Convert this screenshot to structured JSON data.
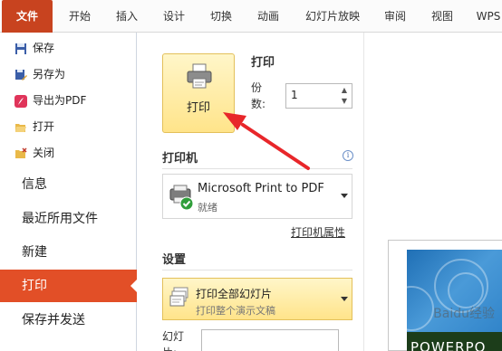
{
  "tabs": [
    "文件",
    "开始",
    "插入",
    "设计",
    "切换",
    "动画",
    "幻灯片放映",
    "审阅",
    "视图",
    "WPS"
  ],
  "nav": {
    "small_items": [
      {
        "label": "保存",
        "icon": "save-icon"
      },
      {
        "label": "另存为",
        "icon": "save-as-icon"
      },
      {
        "label": "导出为PDF",
        "icon": "pdf-icon"
      },
      {
        "label": "打开",
        "icon": "open-folder-icon"
      },
      {
        "label": "关闭",
        "icon": "close-folder-icon"
      }
    ],
    "big_items": [
      "信息",
      "最近所用文件",
      "新建",
      "打印",
      "保存并发送"
    ]
  },
  "print": {
    "section_title": "打印",
    "button_label": "打印",
    "copies_label": "份数:",
    "copies_value": "1",
    "printer_title": "打印机",
    "printer_name": "Microsoft Print to PDF",
    "printer_status": "就绪",
    "printer_props": "打印机属性",
    "settings_title": "设置",
    "slides_option_title": "打印全部幻灯片",
    "slides_option_desc": "打印整个演示文稿",
    "slides_range_label": "幻灯片:"
  },
  "preview": {
    "slide_text": "POWERPO",
    "watermark": "Baidu经验"
  },
  "colors": {
    "file_tab": "#c8431f",
    "active_nav": "#e24f27",
    "button_fill": "#ffe48a",
    "arrow": "#e8262a"
  }
}
